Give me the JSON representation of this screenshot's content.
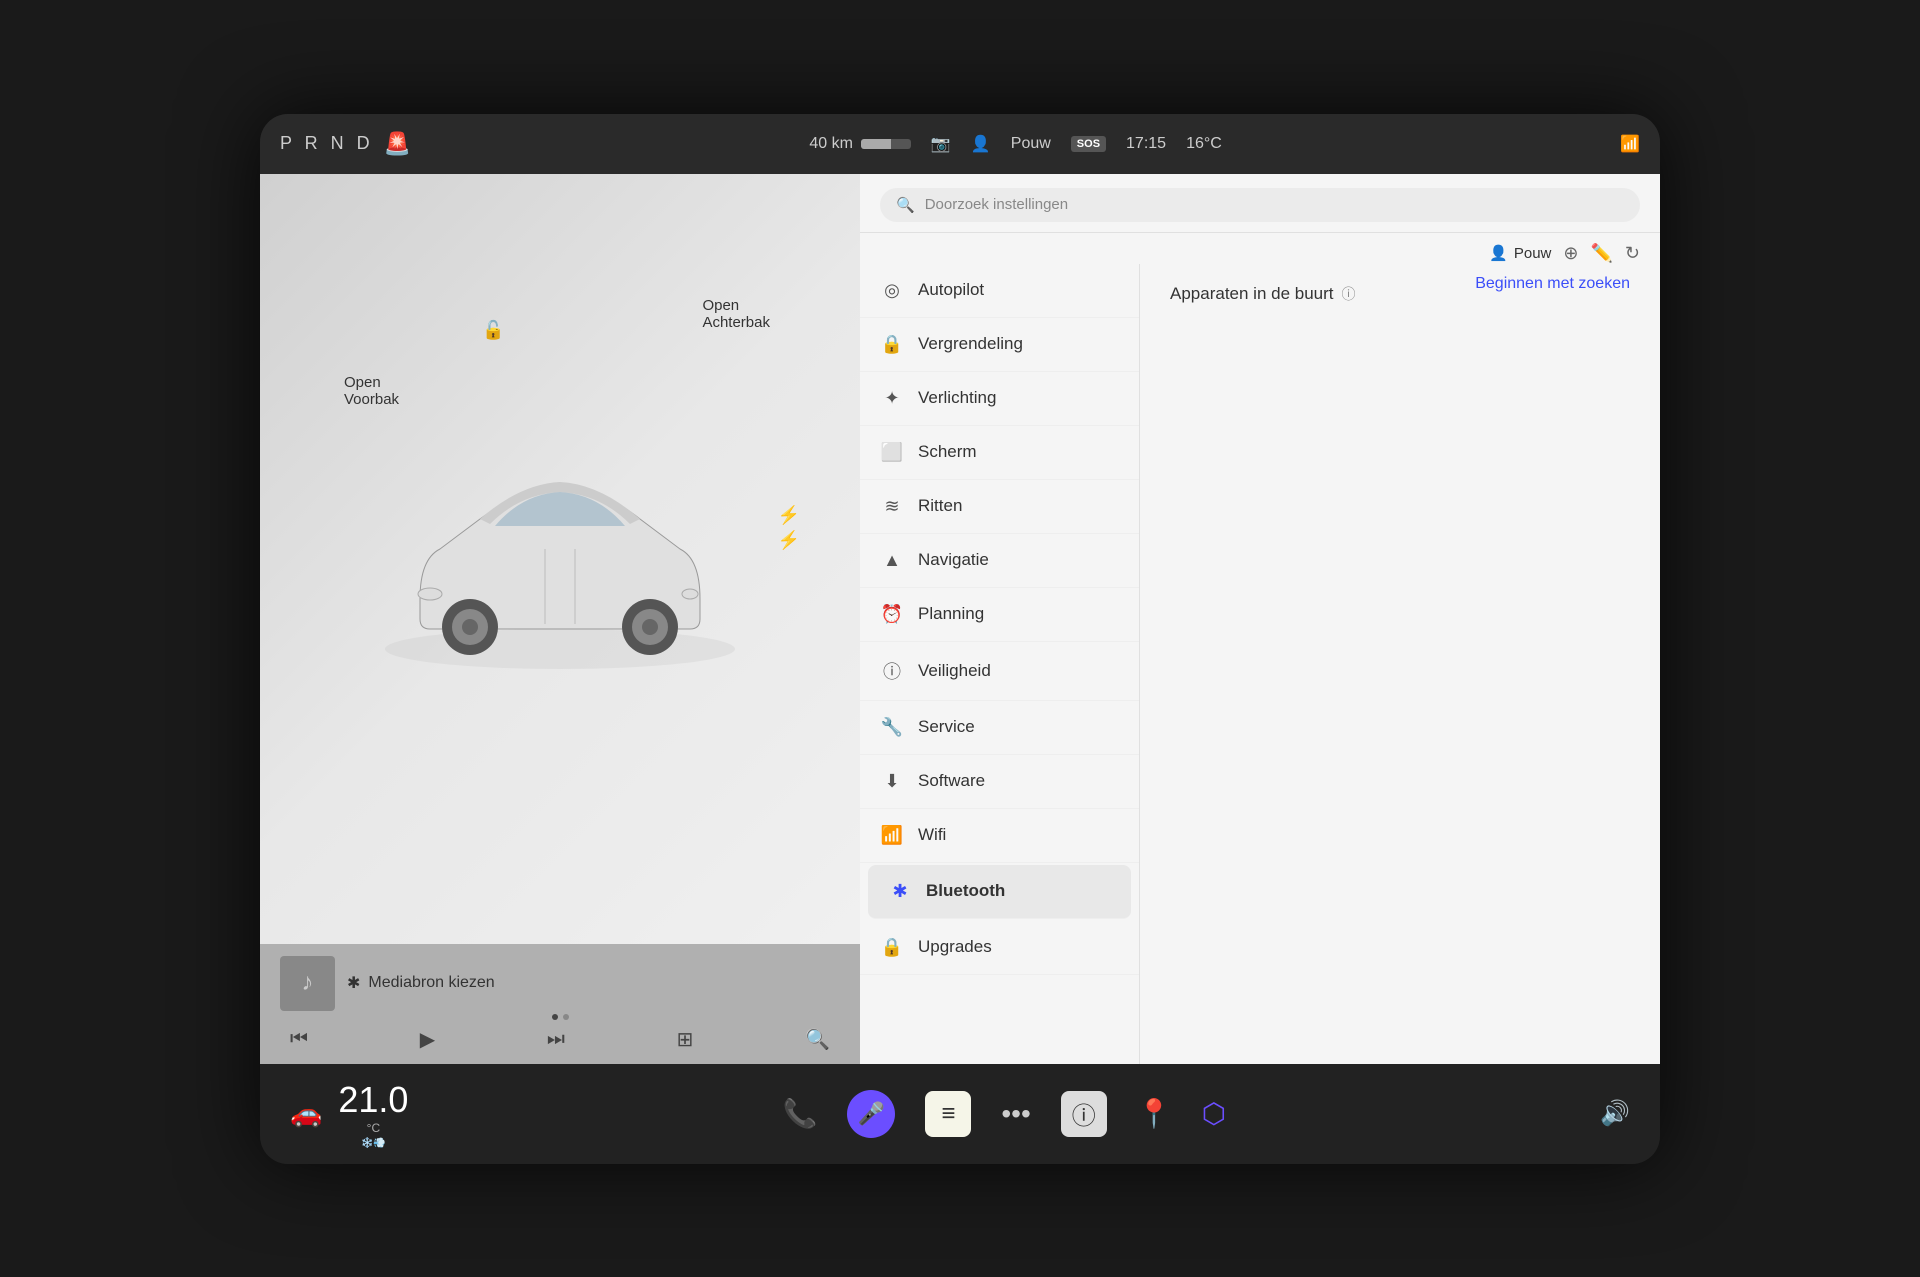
{
  "statusBar": {
    "prnd": "P R N D",
    "range": "40 km",
    "profile": "Pouw",
    "sos": "SOS",
    "time": "17:15",
    "temp": "16°C"
  },
  "carView": {
    "voorbakLabel": "Open\nVoorbak",
    "achterbakLabel": "Open\nAchterbak"
  },
  "mediaPlayer": {
    "sourceLabel": "Mediabron kiezen",
    "btIcon": "✱"
  },
  "settings": {
    "searchPlaceholder": "Doorzoek instellingen",
    "profileName": "Pouw",
    "sectionTitle": "Apparaten in de buurt",
    "beginZoekenBtn": "Beginnen met zoeken",
    "menuItems": [
      {
        "id": "autopilot",
        "label": "Autopilot",
        "icon": "◎"
      },
      {
        "id": "vergrendeling",
        "label": "Vergrendeling",
        "icon": "🔒"
      },
      {
        "id": "verlichting",
        "label": "Verlichting",
        "icon": "✦"
      },
      {
        "id": "scherm",
        "label": "Scherm",
        "icon": "⬜"
      },
      {
        "id": "ritten",
        "label": "Ritten",
        "icon": "〜"
      },
      {
        "id": "navigatie",
        "label": "Navigatie",
        "icon": "▲"
      },
      {
        "id": "planning",
        "label": "Planning",
        "icon": "⏰"
      },
      {
        "id": "veiligheid",
        "label": "Veiligheid",
        "icon": "ⓘ"
      },
      {
        "id": "service",
        "label": "Service",
        "icon": "🔧"
      },
      {
        "id": "software",
        "label": "Software",
        "icon": "⬇"
      },
      {
        "id": "wifi",
        "label": "Wifi",
        "icon": "📶"
      },
      {
        "id": "bluetooth",
        "label": "Bluetooth",
        "icon": "✱",
        "active": true
      },
      {
        "id": "upgrades",
        "label": "Upgrades",
        "icon": "🔒"
      }
    ]
  },
  "taskbar": {
    "temperature": "21.0",
    "tempSub": "°C"
  }
}
